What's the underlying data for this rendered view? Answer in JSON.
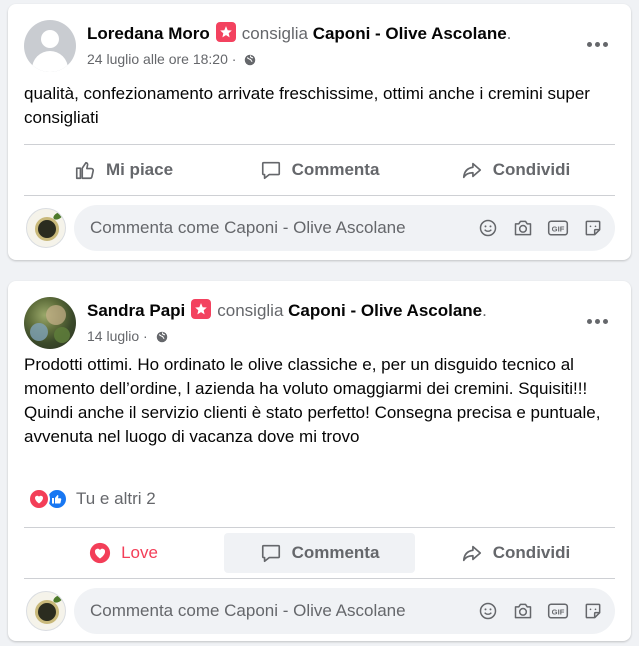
{
  "posts": [
    {
      "author": "Loredana Moro",
      "verb": "consiglia",
      "page": "Caponi - Olive Ascolane",
      "period": ".",
      "timestamp": "24 luglio alle ore 18:20",
      "separator": "·",
      "text": "qualità,  confezionamento arrivate freschissime, ottimi anche i cremini super consigliati",
      "actions": {
        "like": "Mi piace",
        "comment": "Commenta",
        "share": "Condividi"
      },
      "comment_placeholder": "Commenta come Caponi - Olive Ascolane"
    },
    {
      "author": "Sandra Papi",
      "verb": "consiglia",
      "page": "Caponi - Olive Ascolane",
      "period": ".",
      "timestamp": "14 luglio",
      "separator": "·",
      "text": "Prodotti ottimi. Ho ordinato le olive classiche e, per un disguido tecnico al momento dell’ordine, l azienda ha voluto omaggiarmi dei cremini. Squisiti!!! Quindi anche il servizio clienti è stato perfetto! Consegna precisa e puntuale, avvenuta nel luogo di vacanza dove mi trovo",
      "reactions": "Tu e altri 2",
      "actions": {
        "like": "Love",
        "comment": "Commenta",
        "share": "Condividi"
      },
      "comment_placeholder": "Commenta come Caponi - Olive Ascolane"
    }
  ],
  "icons": {
    "recommend": "recommend-star-icon",
    "privacy": "globe-icon",
    "more": "more-options-icon",
    "like": "thumbs-up-icon",
    "love": "heart-icon",
    "comment": "speech-bubble-icon",
    "share": "share-arrow-icon",
    "emoji": "emoji-icon",
    "camera": "camera-icon",
    "gif": "gif-icon",
    "sticker": "sticker-icon"
  },
  "colors": {
    "background": "#f0f2f5",
    "card": "#ffffff",
    "text_primary": "#050505",
    "text_secondary": "#65676b",
    "love": "#f33e58",
    "like": "#1877f2",
    "divider": "#ced0d4"
  }
}
